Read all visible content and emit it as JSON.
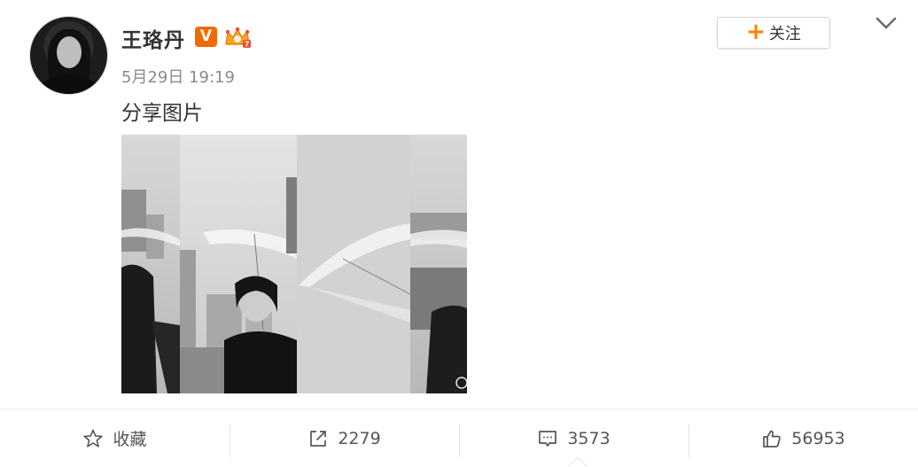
{
  "post": {
    "username": "王珞丹",
    "verified_badge": "V",
    "timestamp": "5月29日 19:19",
    "text": "分享图片",
    "follow_plus": "+",
    "follow_label": "关注"
  },
  "icons": {
    "verified": "verified-v-icon",
    "crown": "vip-crown-icon",
    "menu": "chevron-down-icon",
    "favorite": "star-icon",
    "share": "share-icon",
    "comment": "comment-icon",
    "like": "thumbs-up-icon"
  },
  "actions": {
    "favorite_label": "收藏",
    "share_count": "2279",
    "comment_count": "3573",
    "like_count": "56953"
  },
  "colors": {
    "accent": "#ff8200",
    "badge": "#f06b00",
    "text": "#333333",
    "muted": "#8a8a8a"
  }
}
